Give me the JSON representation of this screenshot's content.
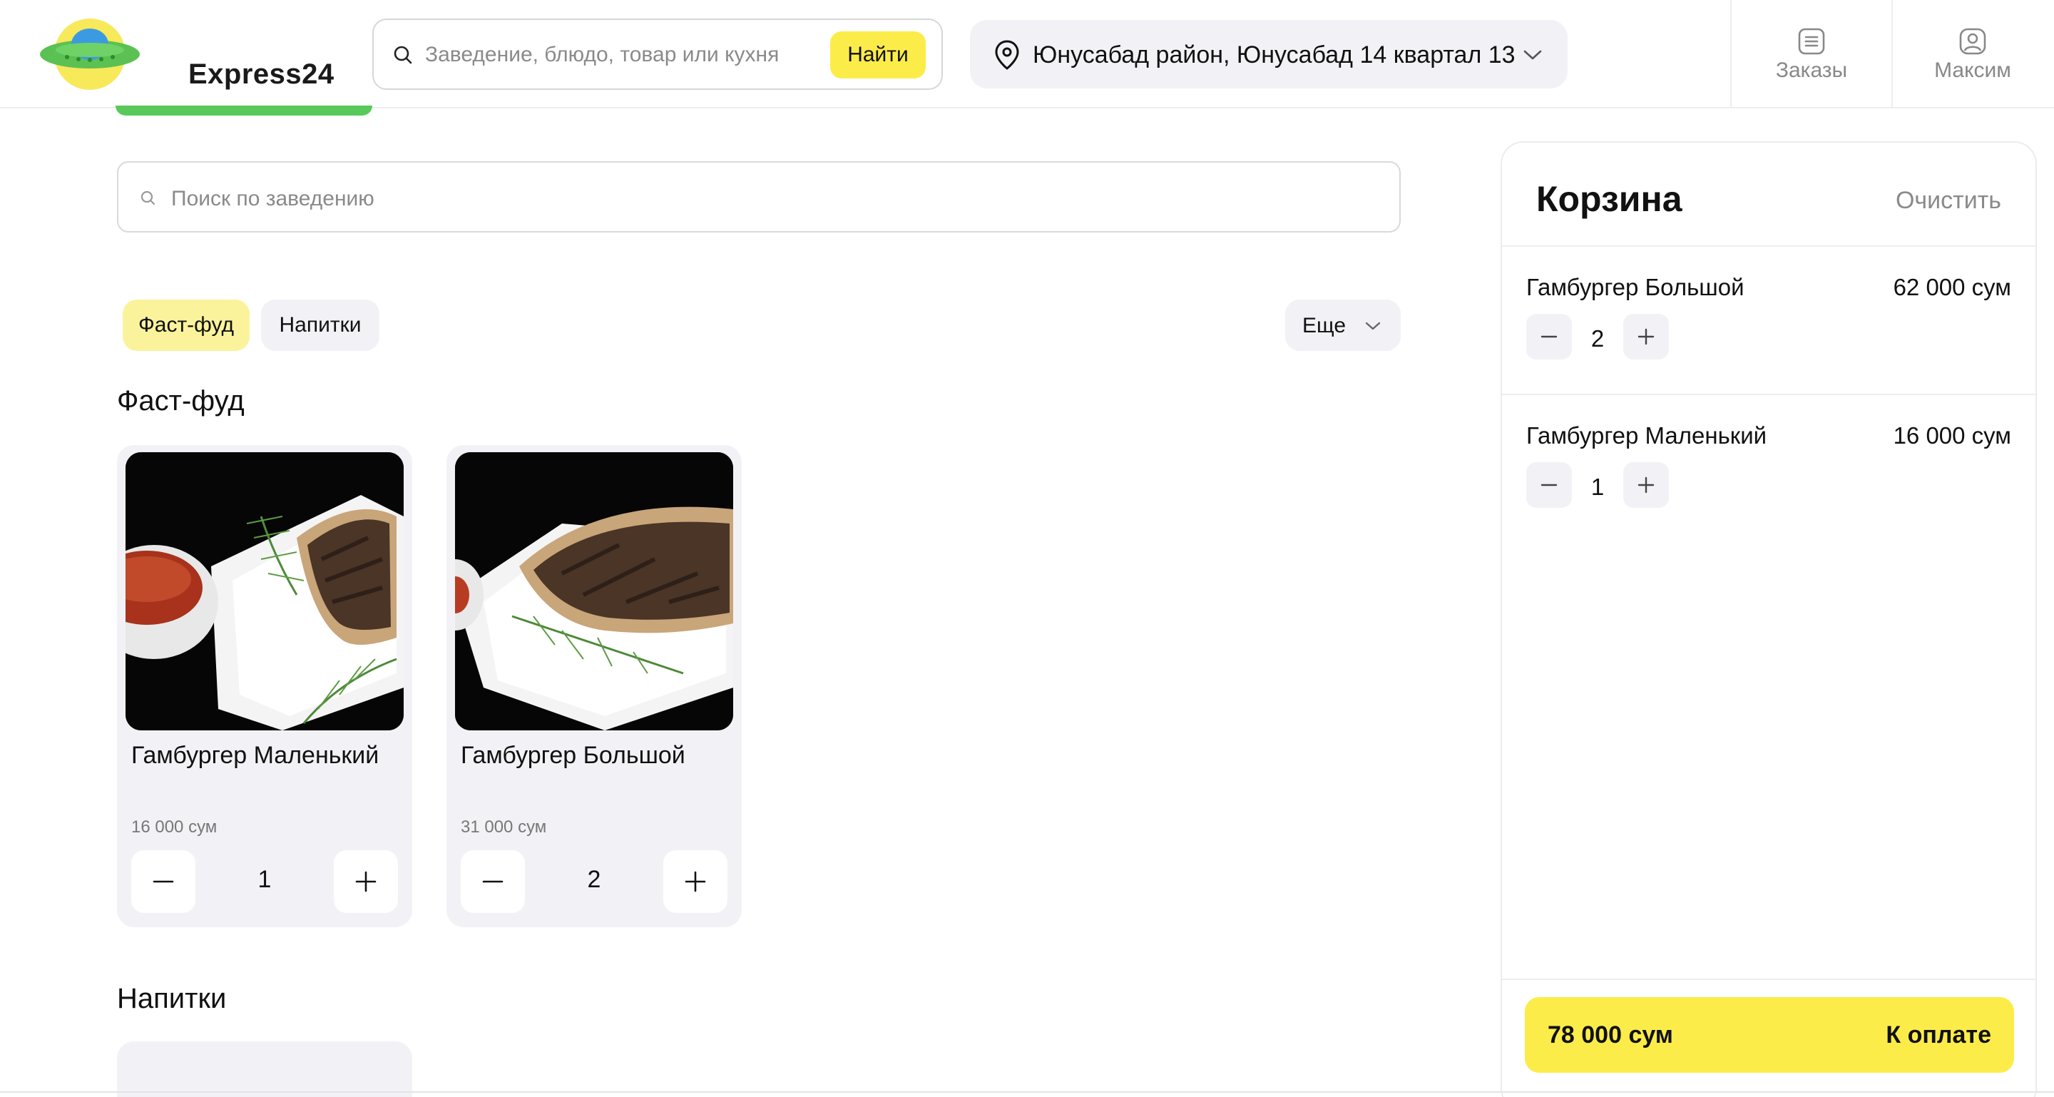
{
  "header": {
    "logo_text": "Express24",
    "search_placeholder": "Заведение, блюдо, товар или кухня",
    "search_button": "Найти",
    "address": "Юнусабад район, Юнусабад 14 квартал 13",
    "nav": [
      {
        "label": "Заказы",
        "icon": "orders-list-icon"
      },
      {
        "label": "Максим",
        "icon": "user-profile-icon"
      }
    ]
  },
  "venue": {
    "search_placeholder": "Поиск по заведению",
    "categories": [
      {
        "label": "Фаст-фуд",
        "active": true
      },
      {
        "label": "Напитки",
        "active": false
      }
    ],
    "more_label": "Еще",
    "sections": [
      {
        "title": "Фаст-фуд",
        "items": [
          {
            "name": "Гамбургер Маленький",
            "price": "16 000 сум",
            "qty": "1"
          },
          {
            "name": "Гамбургер Большой",
            "price": "31 000 сум",
            "qty": "2"
          }
        ]
      },
      {
        "title": "Напитки",
        "items": []
      }
    ]
  },
  "cart": {
    "title": "Корзина",
    "clear_label": "Очистить",
    "items": [
      {
        "name": "Гамбургер Большой",
        "price": "62 000 сум",
        "qty": "2"
      },
      {
        "name": "Гамбургер Маленький",
        "price": "16 000 сум",
        "qty": "1"
      }
    ],
    "total": "78 000 сум",
    "pay_label": "К оплате"
  },
  "colors": {
    "accent_yellow": "#fcec4a",
    "chip_active": "#fbf39b",
    "brand_green": "#59c95b",
    "surface_gray": "#f2f2f6"
  }
}
